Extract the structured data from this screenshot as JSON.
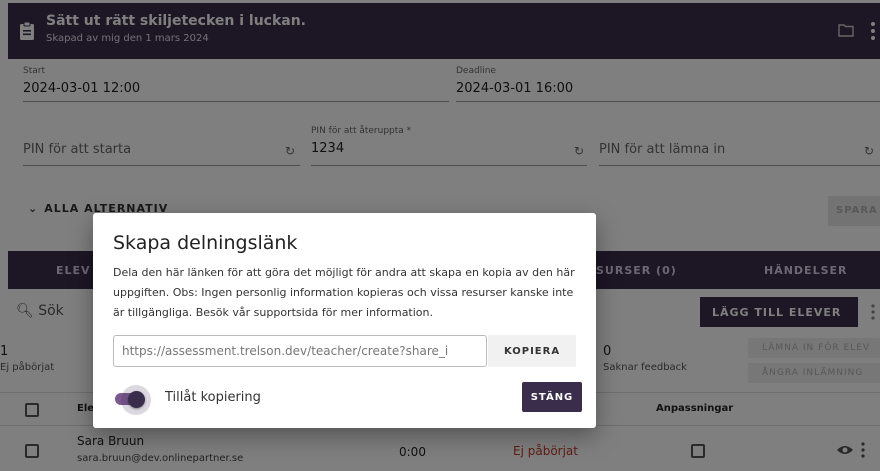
{
  "header": {
    "title": "Sätt ut rätt skiljetecken i luckan.",
    "subtitle": "Skapad av mig den 1 mars 2024"
  },
  "fields": {
    "start_label": "Start",
    "start_value": "2024-03-01 12:00",
    "deadline_label": "Deadline",
    "deadline_value": "2024-03-01 16:00",
    "pin_start_placeholder": "PIN för att starta",
    "pin_resume_label": "PIN för att återuppta *",
    "pin_resume_value": "1234",
    "pin_submit_placeholder": "PIN för att lämna in"
  },
  "options": {
    "all_options_label": "ALLA ALTERNATIV",
    "save_label": "SPARA"
  },
  "tabs": [
    "ELEV",
    "SURSER (0)",
    "HÄNDELSER"
  ],
  "toolbar": {
    "search_label": "Sök",
    "add_students_label": "LÄGG TILL ELEVER"
  },
  "stats": {
    "not_started_count": "1",
    "not_started_label": "Ej påbörjat",
    "missing_feedback_count": "0",
    "missing_feedback_label": "Saknar feedback",
    "submit_for_student_label": "LÄMNA IN FÖR ELEV",
    "undo_submission_label": "ÅNGRA INLÄMNING"
  },
  "table": {
    "col_student": "Ele",
    "col_adjustments": "Anpassningar",
    "rows": [
      {
        "name": "Sara Bruun",
        "email": "sara.bruun@dev.onlinepartner.se",
        "time": "0:00",
        "status": "Ej påbörjat"
      }
    ]
  },
  "dialog": {
    "title": "Skapa delningslänk",
    "description": "Dela den här länken för att göra det möjligt för andra att skapa en kopia av den här uppgiften. Obs: Ingen personlig information kopieras och vissa resurser kanske inte är tillgängliga. Besök vår supportsida för mer information.",
    "link_value": "https://assessment.trelson.dev/teacher/create?share_i",
    "copy_label": "KOPIERA",
    "toggle_label": "Tillåt kopiering",
    "toggle_on": true,
    "close_label": "STÄNG"
  },
  "colors": {
    "primary": "#3a2c4b",
    "status_not_started": "#c0392b"
  }
}
